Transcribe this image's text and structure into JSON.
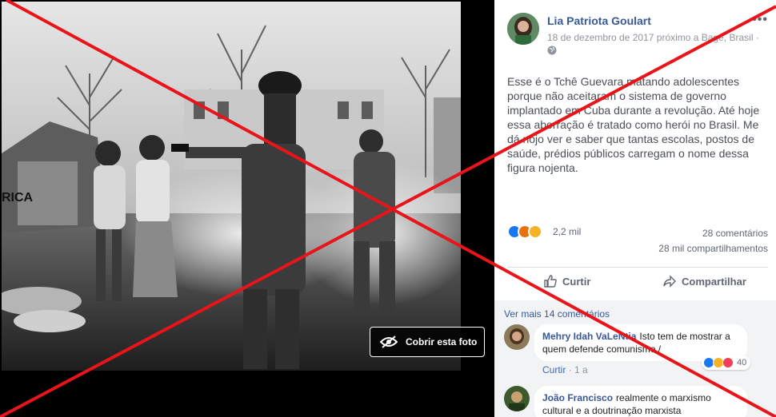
{
  "photo": {
    "cover_button_label": "Cobrir esta foto",
    "graffiti_text": "RICA"
  },
  "post": {
    "author": "Lia Patriota Goulart",
    "meta": "18 de dezembro de 2017 próximo a Bagé, Brasil ·",
    "text": "Esse é o Tchê Guevara matando adolescentes porque não aceitaram o sistema de governo implantado em Cuba durante a revolução. Até hoje essa aberração é tratado como herói no Brasil. Me dá nojo ver e saber que tantas escolas, postos de saúde, prédios públicos carregam o nome dessa figura nojenta.",
    "reaction_count": "2,2 mil",
    "comments_count": "28 comentários",
    "shares_count": "28 mil compartilhamentos",
    "more_icon": "more-options-icon",
    "privacy_icon": "globe-icon"
  },
  "actions": {
    "like_label": "Curtir",
    "share_label": "Compartilhar"
  },
  "comments": {
    "see_more": "Ver mais 14 comentários",
    "items": [
      {
        "name": "Mehry Idah VaLeNtia",
        "text": "Isto tem de mostrar a quem defende comunismo /",
        "like": "Curtir",
        "separator": "·",
        "age": "1 a",
        "reaction_count": "40"
      },
      {
        "name": "João Francisco",
        "text": "realmente o marxismo cultural e a doutrinação marxista"
      }
    ]
  },
  "colors": {
    "link": "#385898",
    "overlay_x": "#e8141a",
    "like_blue": "#1877f2"
  }
}
